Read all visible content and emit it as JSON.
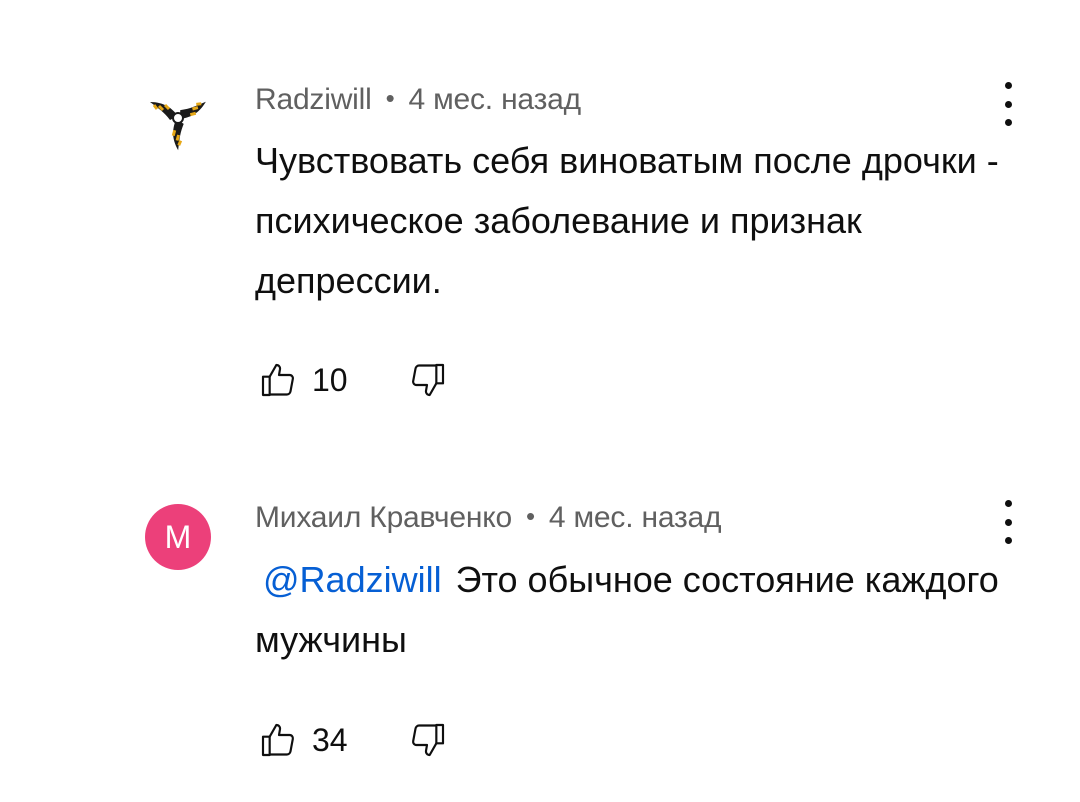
{
  "comments": [
    {
      "author": "Radziwill",
      "separator": "•",
      "time": "4 мес. назад",
      "mention": "",
      "text": "Чувствовать себя виноватым после дрочки - психическое заболевание и признак депрессии.",
      "likes": "10",
      "avatar": {
        "type": "logo",
        "icon": "triskelion-icon"
      }
    },
    {
      "author": "Михаил Кравченко",
      "separator": "•",
      "time": "4 мес. назад",
      "mention": "@Radziwill",
      "text": "Это обычное состояние каждого мужчины",
      "likes": "34",
      "avatar": {
        "type": "letter",
        "letter": "М",
        "color": "#ec407a"
      }
    }
  ],
  "colors": {
    "mention": "#065fd4",
    "meta": "#606060",
    "text": "#0f0f0f"
  }
}
